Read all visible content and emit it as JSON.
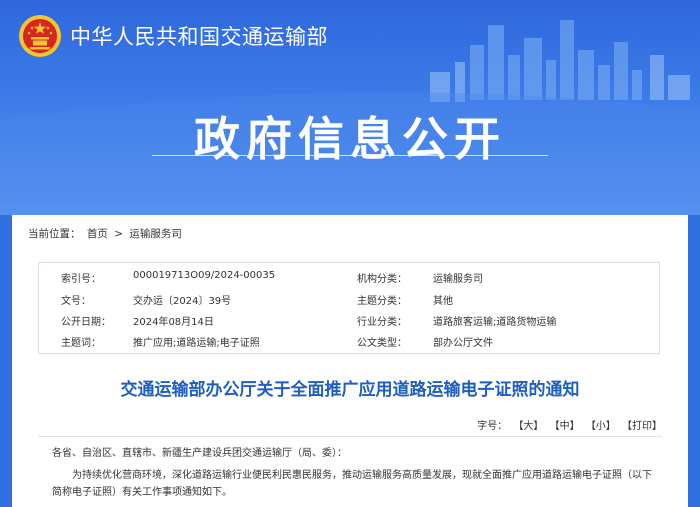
{
  "header": {
    "site_name": "中华人民共和国交通运输部",
    "page_heading": "政府信息公开"
  },
  "breadcrumb": {
    "label": "当前位置：",
    "home": "首页",
    "separator": ">",
    "current": "运输服务司"
  },
  "meta": {
    "rows": [
      {
        "k1": "索引号：",
        "v1": "000019713O09/2024-00035",
        "k2": "机构分类：",
        "v2": "运输服务司"
      },
      {
        "k1": "文号：",
        "v1": "交办运〔2024〕39号",
        "k2": "主题分类：",
        "v2": "其他"
      },
      {
        "k1": "公开日期：",
        "v1": "2024年08月14日",
        "k2": "行业分类：",
        "v2": "道路旅客运输;道路货物运输"
      },
      {
        "k1": "主题词：",
        "v1": "推广应用;道路运输;电子证照",
        "k2": "公文类型：",
        "v2": "部办公厅文件"
      }
    ]
  },
  "document": {
    "title": "交通运输部办公厅关于全面推广应用道路运输电子证照的通知",
    "fontsize_label": "字号：",
    "fontsize_options": [
      "【大】",
      "【中】",
      "【小】",
      "【打印】"
    ],
    "salutation": "各省、自治区、直辖市、新疆生产建设兵团交通运输厅（局、委）：",
    "paragraph1": "为持续优化营商环境，深化道路运输行业便民利民惠民服务，推动运输服务高质量发展，现就全面推广应用道路运输电子证照（以下简称电子证照）有关工作事项通知如下。"
  },
  "colors": {
    "banner_blue": "#2f6fe0",
    "title_blue": "#1d5fbf",
    "emblem_red": "#d7261e",
    "emblem_gold": "#f3c433"
  }
}
